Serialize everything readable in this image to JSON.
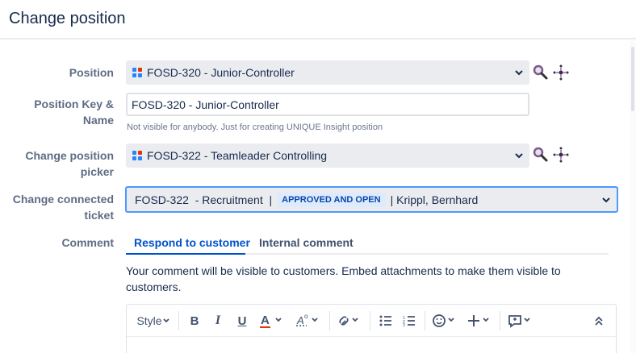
{
  "header": {
    "title": "Change position"
  },
  "fields": {
    "position": {
      "label": "Position",
      "value": "FOSD-320 - Junior-Controller"
    },
    "position_key": {
      "label_line1": "Position Key &",
      "label_line2": "Name",
      "value": "FOSD-320 - Junior-Controller",
      "help": "Not visible for anybody. Just for creating UNIQUE Insight position"
    },
    "change_position_picker": {
      "label_line1": "Change position",
      "label_line2": "picker",
      "value": "FOSD-322 - Teamleader Controlling"
    },
    "change_connected_ticket": {
      "label_line1": "Change connected",
      "label_line2": "ticket",
      "key": "FOSD-322",
      "summary": "  - Recruitment  |",
      "status": "APPROVED AND OPEN",
      "assignee": "| Krippl, Bernhard"
    },
    "comment": {
      "label": "Comment",
      "tabs": [
        "Respond to customer",
        "Internal comment"
      ],
      "note": "Your comment will be visible to customers. Embed attachments to make them visible to customers.",
      "toolbar": {
        "style_label": "Style"
      }
    }
  },
  "colors": {
    "accent": "#0052cc",
    "focus_border": "#4c9aff",
    "lozenge_bg": "#deebff",
    "lozenge_text": "#0747a6",
    "icon_red": "#de350b",
    "icon_blue": "#2684ff"
  },
  "icons": [
    "grid-icon",
    "magnifier-icon",
    "move-icon",
    "chevron-down-icon",
    "bold-icon",
    "italic-icon",
    "underline-icon",
    "text-color-icon",
    "clear-format-icon",
    "link-icon",
    "bullet-list-icon",
    "numbered-list-icon",
    "emoji-icon",
    "plus-icon",
    "feedback-icon",
    "collapse-icon"
  ]
}
